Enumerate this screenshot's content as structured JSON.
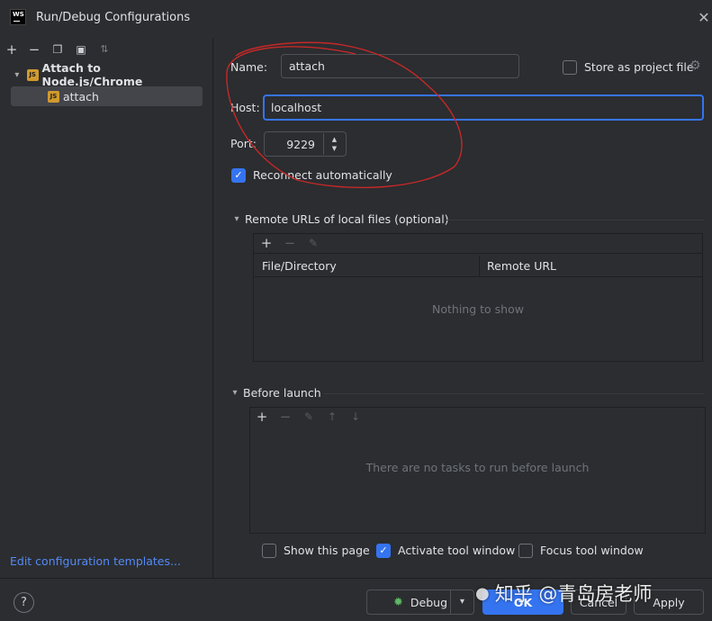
{
  "window": {
    "title": "Run/Debug Configurations",
    "app_logo_text": "WS"
  },
  "left": {
    "tree": {
      "group_label": "Attach to Node.js/Chrome",
      "item_label": "attach"
    },
    "edit_templates_link": "Edit configuration templates..."
  },
  "form": {
    "name_label": "Name:",
    "name_value": "attach",
    "store_label": "Store as project file",
    "host_label": "Host:",
    "host_value": "localhost",
    "port_label": "Port:",
    "port_value": "9229",
    "reconnect_label": "Reconnect automatically",
    "reconnect_checked": true
  },
  "remote_urls": {
    "title": "Remote URLs of local files (optional)",
    "columns": [
      "File/Directory",
      "Remote URL"
    ],
    "empty_text": "Nothing to show"
  },
  "before_launch": {
    "title": "Before launch",
    "empty_text": "There are no tasks to run before launch"
  },
  "options": {
    "show_page_label": "Show this page",
    "activate_label": "Activate tool window",
    "focus_label": "Focus tool window"
  },
  "buttons": {
    "help": "?",
    "debug": "Debug",
    "ok": "OK",
    "cancel": "Cancel",
    "apply": "Apply"
  },
  "watermark": {
    "text": "知乎 @青岛房老师"
  },
  "colors": {
    "background": "#2b2d30",
    "accent": "#3574f0",
    "link": "#548af7",
    "annotation": "#c62828"
  }
}
